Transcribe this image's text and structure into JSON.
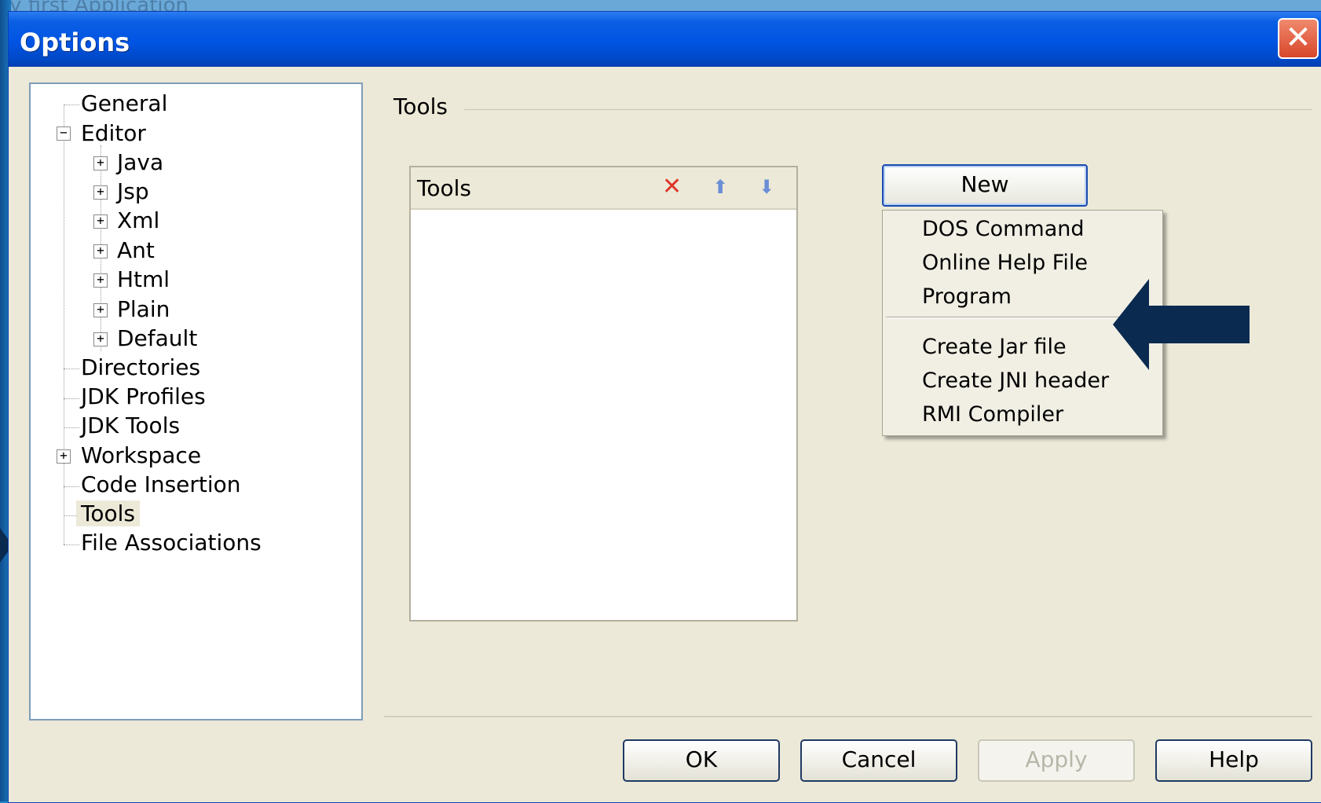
{
  "background": {
    "window_title": "y first Application"
  },
  "dialog": {
    "title": "Options",
    "close_icon": "close-x-icon"
  },
  "tree": {
    "items": [
      {
        "label": "General"
      },
      {
        "label": "Editor",
        "expander": "−"
      },
      {
        "label": "Java",
        "expander": "+"
      },
      {
        "label": "Jsp",
        "expander": "+"
      },
      {
        "label": "Xml",
        "expander": "+"
      },
      {
        "label": "Ant",
        "expander": "+"
      },
      {
        "label": "Html",
        "expander": "+"
      },
      {
        "label": "Plain",
        "expander": "+"
      },
      {
        "label": "Default",
        "expander": "+"
      },
      {
        "label": "Directories"
      },
      {
        "label": "JDK Profiles"
      },
      {
        "label": "JDK Tools"
      },
      {
        "label": "Workspace",
        "expander": "+"
      },
      {
        "label": "Code Insertion"
      },
      {
        "label": "Tools",
        "selected": true
      },
      {
        "label": "File Associations"
      }
    ]
  },
  "panel": {
    "group_title": "Tools",
    "list_header": "Tools",
    "icons": [
      "delete-icon",
      "move-up-icon",
      "move-down-icon"
    ],
    "new_button": "New",
    "menu": {
      "items": [
        "DOS Command",
        "Online Help File",
        "Program",
        "Create Jar file",
        "Create JNI header",
        "RMI Compiler"
      ]
    }
  },
  "buttons": {
    "ok": "OK",
    "cancel": "Cancel",
    "apply": "Apply",
    "help": "Help"
  },
  "colors": {
    "titlebar": "#0054e3",
    "dialog_bg": "#ece9d8",
    "arrow": "#0a2a50",
    "delete": "#e0352a",
    "arrow_icons": "#6b8fd6"
  }
}
